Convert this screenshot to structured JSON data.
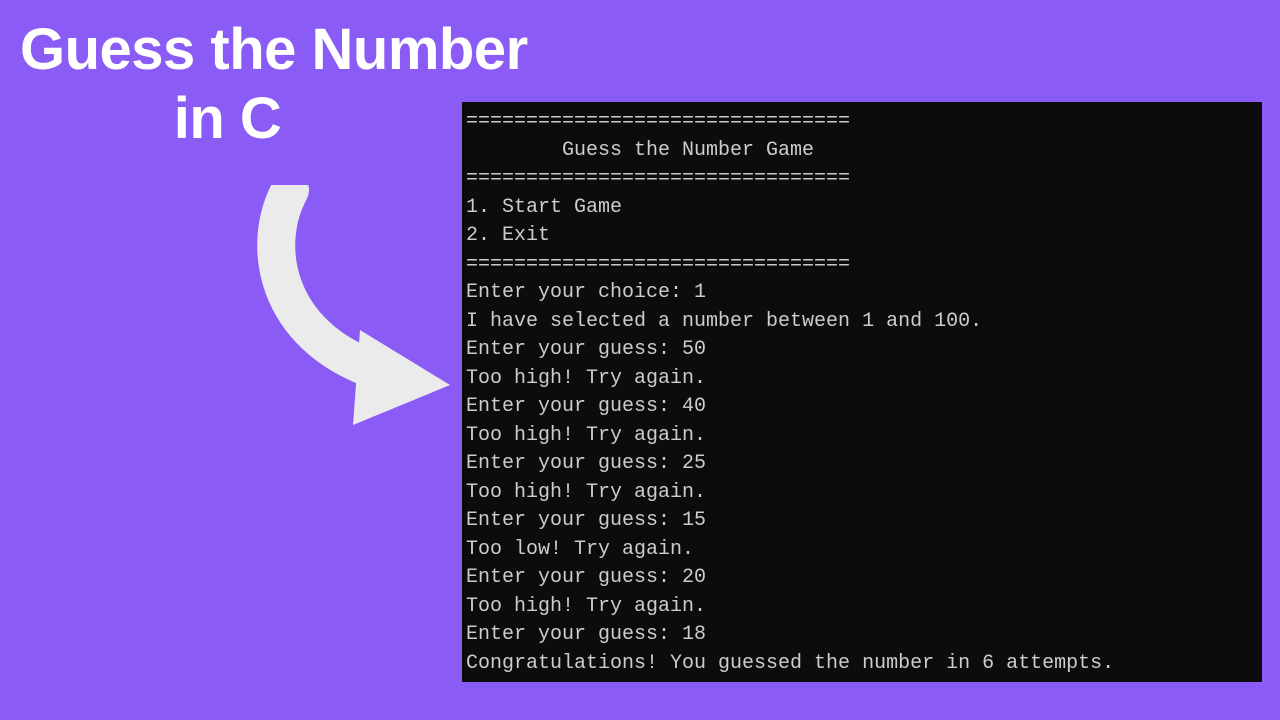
{
  "heading": {
    "line1": "Guess the Number",
    "line2": "in C"
  },
  "terminal": {
    "divider": "================================",
    "banner_title": "Guess the Number Game",
    "menu": {
      "opt1": "1. Start Game",
      "opt2": "2. Exit"
    },
    "choice_prompt": "Enter your choice: 1",
    "selected_msg": "I have selected a number between 1 and 100.",
    "guesses": [
      {
        "prompt": "Enter your guess: 50",
        "reply": "Too high! Try again."
      },
      {
        "prompt": "Enter your guess: 40",
        "reply": "Too high! Try again."
      },
      {
        "prompt": "Enter your guess: 25",
        "reply": "Too high! Try again."
      },
      {
        "prompt": "Enter your guess: 15",
        "reply": "Too low! Try again."
      },
      {
        "prompt": "Enter your guess: 20",
        "reply": "Too high! Try again."
      },
      {
        "prompt": "Enter your guess: 18",
        "reply": "Congratulations! You guessed the number in 6 attempts."
      }
    ]
  }
}
